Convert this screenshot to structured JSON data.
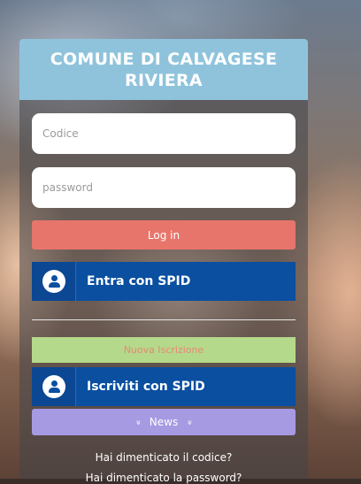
{
  "header": {
    "title": "COMUNE DI CALVAGESE RIVIERA"
  },
  "form": {
    "code_placeholder": "Codice",
    "password_placeholder": "password",
    "login_label": "Log in"
  },
  "spid": {
    "enter_label": "Entra con SPID",
    "register_label": "Iscriviti con SPID"
  },
  "register": {
    "new_label": "Nuova Iscrizione"
  },
  "news": {
    "label": "News",
    "chevron": "»"
  },
  "links": {
    "forgot_code": "Hai dimenticato il codice?",
    "forgot_password": "Hai dimenticato la password?"
  },
  "colors": {
    "header_bg": "#8fc3dc",
    "login_btn": "#e8756b",
    "spid_btn": "#0a4fa0",
    "new_btn": "#b5d98a",
    "news_btn": "#a69ae3"
  }
}
